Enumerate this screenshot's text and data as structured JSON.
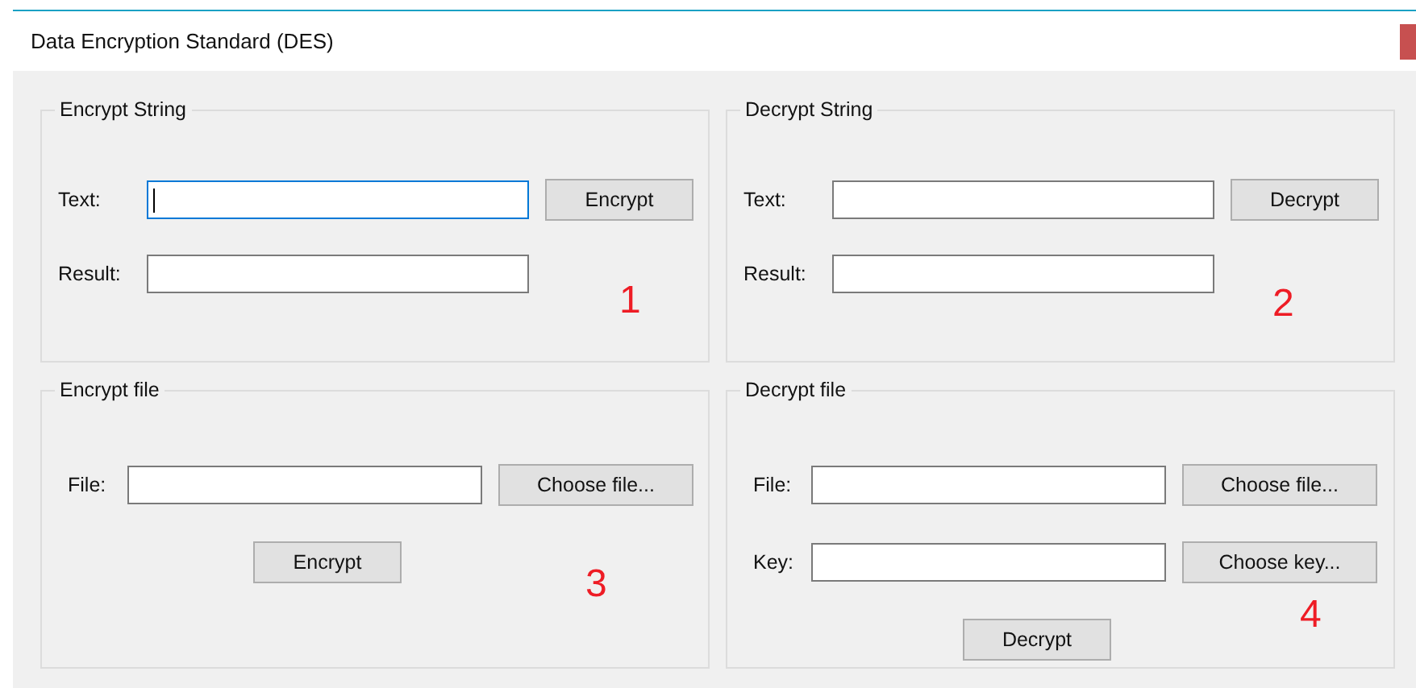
{
  "window": {
    "title": "Data Encryption Standard (DES)"
  },
  "groups": [
    {
      "kind": "string",
      "title": "Encrypt String",
      "marker": "1",
      "rows": [
        {
          "label": "Text:",
          "focused": true,
          "button": "Encrypt"
        },
        {
          "label": "Result:",
          "focused": false
        }
      ]
    },
    {
      "kind": "string",
      "title": "Decrypt String",
      "marker": "2",
      "rows": [
        {
          "label": "Text:",
          "focused": false,
          "button": "Decrypt"
        },
        {
          "label": "Result:",
          "focused": false
        }
      ]
    },
    {
      "kind": "file",
      "title": "Encrypt file",
      "marker": "3",
      "rows": [
        {
          "label": "File:",
          "focused": false,
          "button": "Choose file..."
        }
      ],
      "action": "Encrypt"
    },
    {
      "kind": "file",
      "title": "Decrypt file",
      "marker": "4",
      "rows": [
        {
          "label": "File:",
          "focused": false,
          "button": "Choose file..."
        },
        {
          "label": "Key:",
          "focused": false,
          "button": "Choose key..."
        }
      ],
      "action": "Decrypt"
    }
  ]
}
